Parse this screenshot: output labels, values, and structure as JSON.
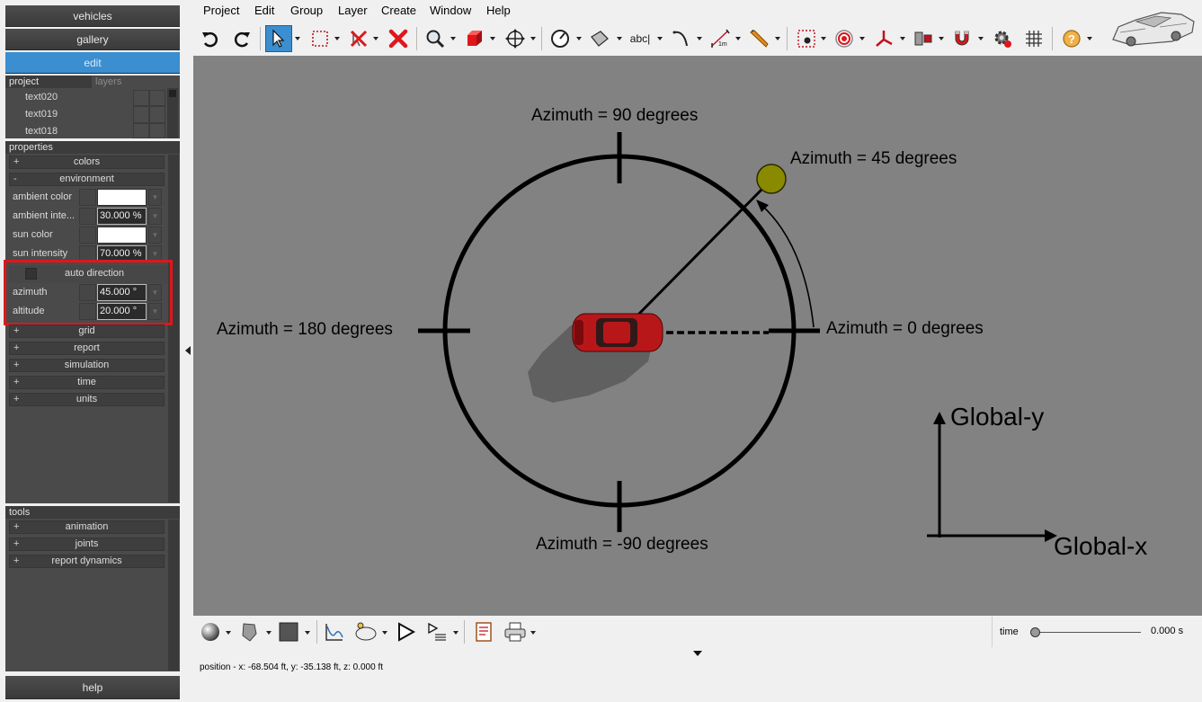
{
  "nav": {
    "vehicles": "vehicles",
    "gallery": "gallery",
    "edit": "edit",
    "help": "help"
  },
  "project_panel": {
    "tab_project": "project",
    "tab_layers": "layers",
    "items": [
      "text020",
      "text019",
      "text018"
    ]
  },
  "properties": {
    "header": "properties",
    "colors": "colors",
    "environment": "environment",
    "ambient_color_label": "ambient color",
    "ambient_intensity_label": "ambient inte...",
    "ambient_intensity_value": "30.000 %",
    "sun_color_label": "sun color",
    "sun_intensity_label": "sun intensity",
    "sun_intensity_value": "70.000 %",
    "auto_direction": "auto direction",
    "azimuth_label": "azimuth",
    "azimuth_value": "45.000 °",
    "altitude_label": "altitude",
    "altitude_value": "20.000 °",
    "groups": [
      "grid",
      "report",
      "simulation",
      "time",
      "units"
    ],
    "plus": "+",
    "minus": "-"
  },
  "tools": {
    "header": "tools",
    "groups": [
      "animation",
      "joints",
      "report dynamics"
    ]
  },
  "menu": [
    "Project",
    "Edit",
    "Group",
    "Layer",
    "Create",
    "Window",
    "Help"
  ],
  "toolbar_icons": [
    "undo-icon",
    "redo-icon",
    "select-arrow-icon",
    "selection-box-icon",
    "unselect-icon",
    "delete-icon",
    "zoom-icon",
    "cube-icon",
    "move-icon",
    "measure-angle-icon",
    "surface-icon",
    "text-icon",
    "curve-icon",
    "distance-icon",
    "pencil-icon",
    "target-icon",
    "record-icon",
    "axis-icon",
    "joint-icon",
    "magnet-icon",
    "gear-icon",
    "grid-icon",
    "help-icon",
    "car-logo-icon"
  ],
  "text_tool_label": "abc|",
  "distance_tool_label": "1m",
  "viewport": {
    "label_90": "Azimuth = 90 degrees",
    "label_45": "Azimuth = 45 degrees",
    "label_180": "Azimuth = 180 degrees",
    "label_0": "Azimuth = 0 degrees",
    "label_neg90": "Azimuth = -90 degrees",
    "global_y": "Global-y",
    "global_x": "Global-x",
    "sun_color": "#8a8a00",
    "car_color": "#b8171a",
    "background": "#828282"
  },
  "bottom_icons": [
    "sphere-icon",
    "shading-icon",
    "color-square-icon",
    "chart-icon",
    "camera-icon",
    "play-icon",
    "playlist-icon",
    "report-icon",
    "print-icon"
  ],
  "time": {
    "label": "time",
    "value": "0.000 s",
    "slider_fraction": 0
  },
  "status": "position - x: -68.504 ft, y: -35.138 ft, z: 0.000 ft"
}
